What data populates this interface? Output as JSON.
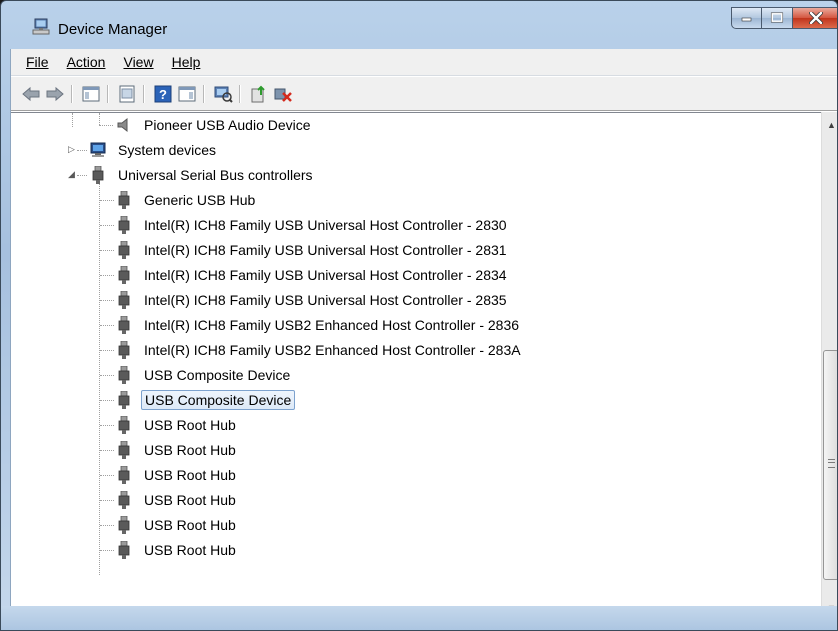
{
  "window": {
    "title": "Device Manager"
  },
  "menubar": {
    "items": [
      {
        "label": "File"
      },
      {
        "label": "Action"
      },
      {
        "label": "View"
      },
      {
        "label": "Help"
      }
    ]
  },
  "toolbar": {
    "icons": [
      "back-icon",
      "forward-icon",
      "show-hide-console-tree-icon",
      "properties-icon",
      "help-icon",
      "show-action-pane-icon",
      "scan-hardware-icon",
      "update-driver-icon",
      "uninstall-device-icon"
    ]
  },
  "tree": {
    "rows": [
      {
        "label": "Pioneer USB Audio Device",
        "icon": "speaker-icon"
      },
      {
        "label": "System devices",
        "icon": "computer-icon"
      },
      {
        "label": "Universal Serial Bus controllers",
        "icon": "usb-plug-icon"
      },
      {
        "label": "Generic USB Hub",
        "icon": "usb-plug-icon"
      },
      {
        "label": "Intel(R) ICH8 Family USB Universal Host Controller - 2830",
        "icon": "usb-plug-icon"
      },
      {
        "label": "Intel(R) ICH8 Family USB Universal Host Controller - 2831",
        "icon": "usb-plug-icon"
      },
      {
        "label": "Intel(R) ICH8 Family USB Universal Host Controller - 2834",
        "icon": "usb-plug-icon"
      },
      {
        "label": "Intel(R) ICH8 Family USB Universal Host Controller - 2835",
        "icon": "usb-plug-icon"
      },
      {
        "label": "Intel(R) ICH8 Family USB2 Enhanced Host Controller - 2836",
        "icon": "usb-plug-icon"
      },
      {
        "label": "Intel(R) ICH8 Family USB2 Enhanced Host Controller - 283A",
        "icon": "usb-plug-icon"
      },
      {
        "label": "USB Composite Device",
        "icon": "usb-plug-icon"
      },
      {
        "label": "USB Composite Device",
        "icon": "usb-plug-icon",
        "selected": true
      },
      {
        "label": "USB Root Hub",
        "icon": "usb-plug-icon"
      },
      {
        "label": "USB Root Hub",
        "icon": "usb-plug-icon"
      },
      {
        "label": "USB Root Hub",
        "icon": "usb-plug-icon"
      },
      {
        "label": "USB Root Hub",
        "icon": "usb-plug-icon"
      },
      {
        "label": "USB Root Hub",
        "icon": "usb-plug-icon"
      },
      {
        "label": "USB Root Hub",
        "icon": "usb-plug-icon"
      }
    ]
  },
  "statusbar": {
    "panes": [
      "",
      "",
      ""
    ]
  },
  "colors": {
    "title_bar": "#b9d1ea",
    "close_button": "#c94a32",
    "selection_border": "#7da2ce"
  }
}
